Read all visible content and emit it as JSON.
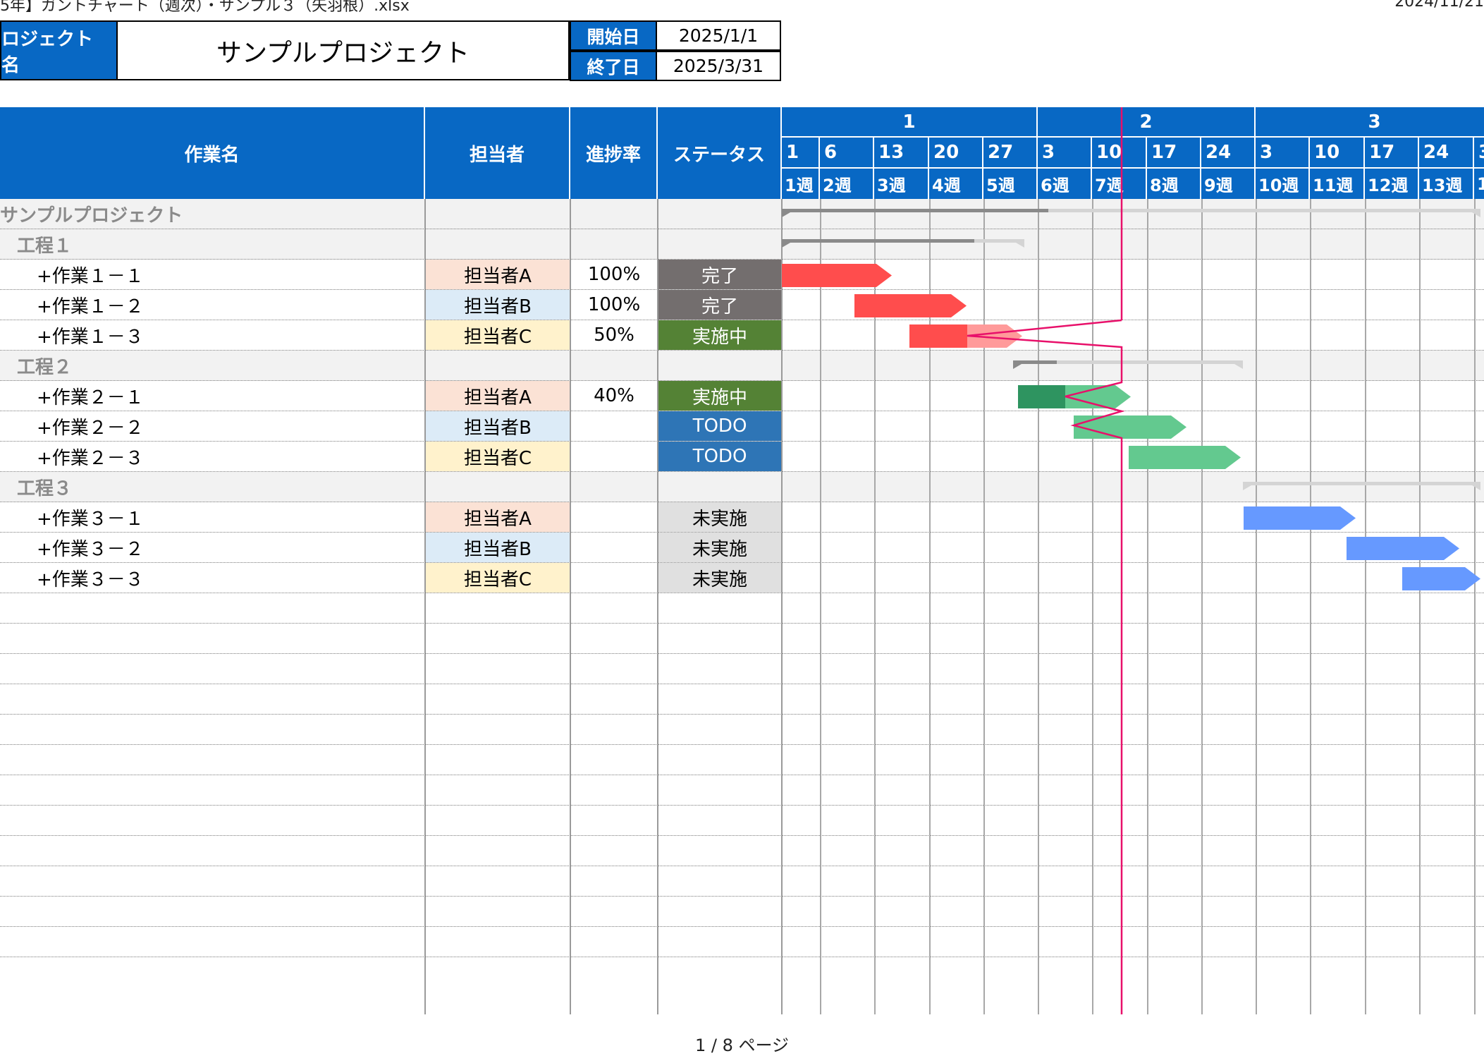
{
  "file_title": "5年】ガントチャート（週次）・サンプル３（矢羽根）.xlsx",
  "print_date": "2024/11/21",
  "project": {
    "label": "ロジェクト名",
    "name": "サンプルプロジェクト"
  },
  "dates": {
    "start_label": "開始日",
    "start": "2025/1/1",
    "end_label": "終了日",
    "end": "2025/3/31"
  },
  "columns": {
    "task": "作業名",
    "assignee": "担当者",
    "progress": "進捗率",
    "status": "ステータス"
  },
  "months": [
    "1",
    "2",
    "3"
  ],
  "days": [
    "1",
    "6",
    "13",
    "20",
    "27",
    "3",
    "10",
    "17",
    "24",
    "3",
    "10",
    "17",
    "24",
    "3"
  ],
  "weeks": [
    "1週",
    "2週",
    "3週",
    "4週",
    "5週",
    "6週",
    "7週",
    "8週",
    "9週",
    "10週",
    "11週",
    "12週",
    "13週",
    "1"
  ],
  "rows": [
    {
      "type": "project",
      "name": "サンプルプロジェクト",
      "assignee": "",
      "progress": "",
      "status": ""
    },
    {
      "type": "group",
      "name": "工程１",
      "assignee": "",
      "progress": "",
      "status": ""
    },
    {
      "type": "task",
      "name": "+作業１－１",
      "assignee": "担当者A",
      "progress": "100%",
      "status": "完了"
    },
    {
      "type": "task",
      "name": "+作業１－２",
      "assignee": "担当者B",
      "progress": "100%",
      "status": "完了"
    },
    {
      "type": "task",
      "name": "+作業１－３",
      "assignee": "担当者C",
      "progress": "50%",
      "status": "実施中"
    },
    {
      "type": "group",
      "name": "工程２",
      "assignee": "",
      "progress": "",
      "status": ""
    },
    {
      "type": "task",
      "name": "+作業２－１",
      "assignee": "担当者A",
      "progress": "40%",
      "status": "実施中"
    },
    {
      "type": "task",
      "name": "+作業２－２",
      "assignee": "担当者B",
      "progress": "",
      "status": "TODO"
    },
    {
      "type": "task",
      "name": "+作業２－３",
      "assignee": "担当者C",
      "progress": "",
      "status": "TODO"
    },
    {
      "type": "group",
      "name": "工程３",
      "assignee": "",
      "progress": "",
      "status": ""
    },
    {
      "type": "task",
      "name": "+作業３－１",
      "assignee": "担当者A",
      "progress": "",
      "status": "未実施"
    },
    {
      "type": "task",
      "name": "+作業３－２",
      "assignee": "担当者B",
      "progress": "",
      "status": "未実施"
    },
    {
      "type": "task",
      "name": "+作業３－３",
      "assignee": "担当者C",
      "progress": "",
      "status": "未実施"
    }
  ],
  "colors": {
    "header": "#0868c4",
    "assignee": {
      "担当者A": "#fbe2d5",
      "担当者B": "#dcebf7",
      "担当者C": "#fff2cc"
    },
    "status": {
      "完了": "#736e6e",
      "実施中": "#548235",
      "TODO": "#2e75b6",
      "未実施": "#e0e0e0"
    },
    "today_line": "#e8106a"
  },
  "footer": "1 / 8 ページ"
}
